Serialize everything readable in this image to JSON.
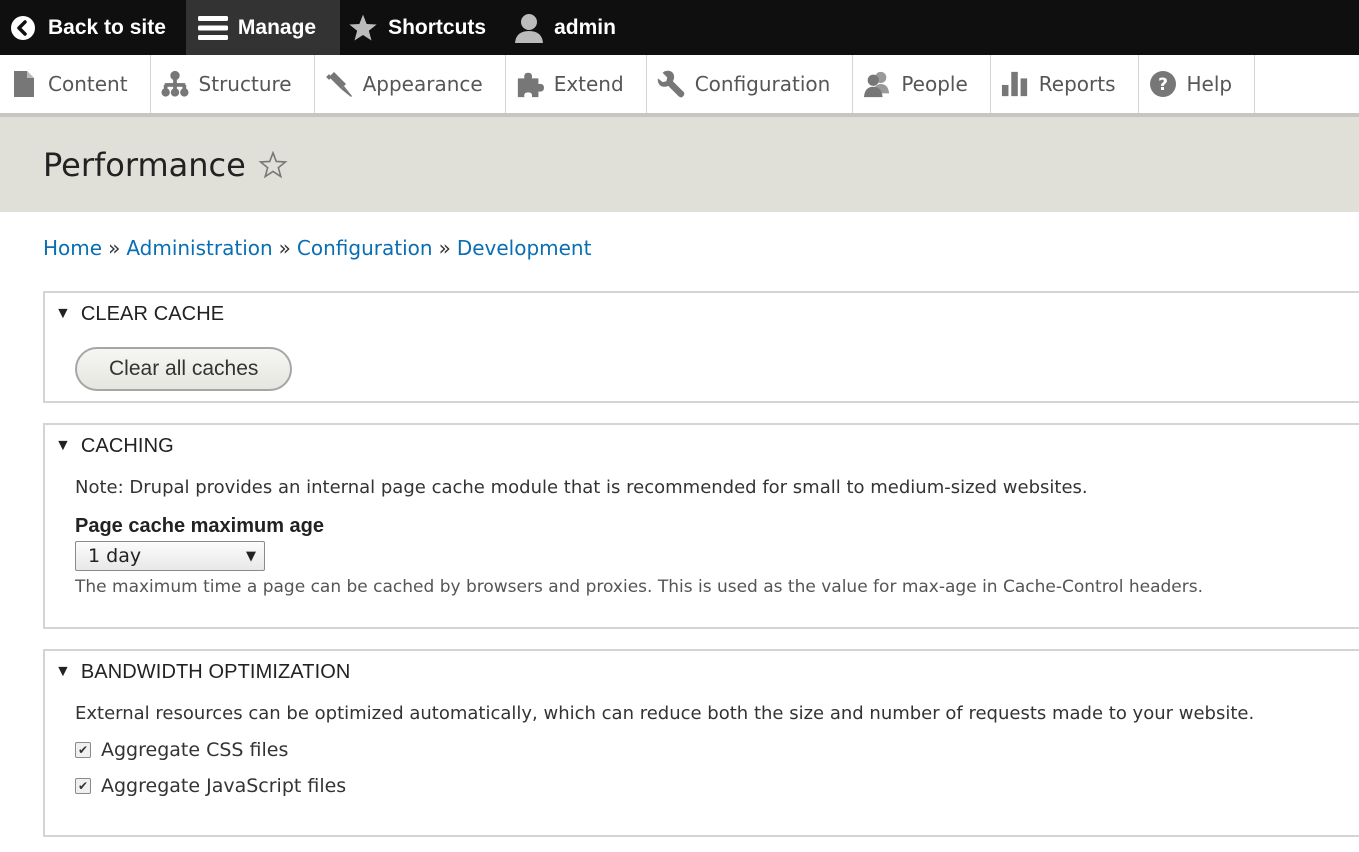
{
  "toolbar": {
    "back": "Back to site",
    "manage": "Manage",
    "shortcuts": "Shortcuts",
    "user": "admin"
  },
  "tray": {
    "items": [
      {
        "label": "Content",
        "icon": "file-icon"
      },
      {
        "label": "Structure",
        "icon": "sitemap-icon"
      },
      {
        "label": "Appearance",
        "icon": "paintbrush-icon"
      },
      {
        "label": "Extend",
        "icon": "puzzle-icon"
      },
      {
        "label": "Configuration",
        "icon": "wrench-icon"
      },
      {
        "label": "People",
        "icon": "people-icon"
      },
      {
        "label": "Reports",
        "icon": "bar-chart-icon"
      },
      {
        "label": "Help",
        "icon": "help-icon"
      }
    ]
  },
  "page": {
    "title": "Performance"
  },
  "breadcrumb": {
    "items": [
      "Home",
      "Administration",
      "Configuration",
      "Development"
    ],
    "separator": "»"
  },
  "clear_cache": {
    "title": "CLEAR CACHE",
    "button": "Clear all caches"
  },
  "caching": {
    "title": "CACHING",
    "note": "Note: Drupal provides an internal page cache module that is recommended for small to medium-sized websites.",
    "max_age_label": "Page cache maximum age",
    "max_age_value": "1 day",
    "max_age_desc": "The maximum time a page can be cached by browsers and proxies. This is used as the value for max-age in Cache-Control headers."
  },
  "bandwidth": {
    "title": "BANDWIDTH OPTIMIZATION",
    "desc": "External resources can be optimized automatically, which can reduce both the size and number of requests made to your website.",
    "aggregate_css": "Aggregate CSS files",
    "aggregate_js": "Aggregate JavaScript files",
    "aggregate_css_checked": true,
    "aggregate_js_checked": true
  },
  "colors": {
    "toolbar_bg": "#0f0f0f",
    "link": "#0a6eb4",
    "header_band": "#e0e0d8"
  }
}
